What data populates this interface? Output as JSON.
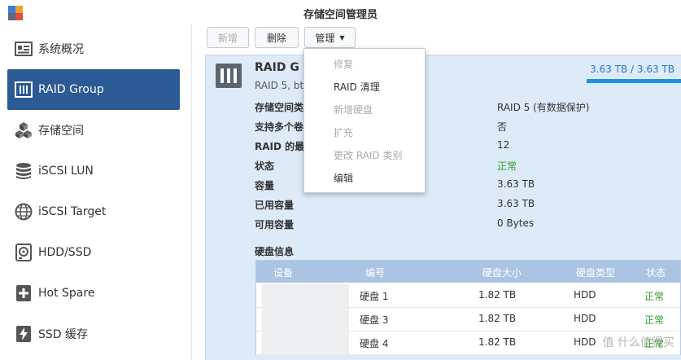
{
  "window": {
    "title": "存储空间管理员"
  },
  "sidebar": {
    "items": [
      {
        "label": "系统概况",
        "icon": "overview-icon"
      },
      {
        "label": "RAID Group",
        "icon": "raid-icon",
        "active": true
      },
      {
        "label": "存储空间",
        "icon": "cubes-icon"
      },
      {
        "label": "iSCSI LUN",
        "icon": "database-icon"
      },
      {
        "label": "iSCSI Target",
        "icon": "globe-icon"
      },
      {
        "label": "HDD/SSD",
        "icon": "disk-icon"
      },
      {
        "label": "Hot Spare",
        "icon": "hot-spare-icon"
      },
      {
        "label": "SSD 缓存",
        "icon": "lightning-icon"
      }
    ]
  },
  "toolbar": {
    "new_label": "新增",
    "delete_label": "删除",
    "manage_label": "管理"
  },
  "manage_menu": {
    "items": [
      {
        "label": "修复",
        "enabled": false
      },
      {
        "label": "RAID 清理",
        "enabled": true
      },
      {
        "label": "新增硬盘",
        "enabled": false
      },
      {
        "label": "扩充",
        "enabled": false
      },
      {
        "label": "更改 RAID 类别",
        "enabled": false
      },
      {
        "label": "编辑",
        "enabled": true
      }
    ]
  },
  "raid": {
    "title": "RAID G",
    "subtitle": "RAID 5, bt",
    "capacity_text": "3.63 TB / 3.63 TB",
    "capacity_used_fraction": 1.0,
    "info": [
      {
        "label": "存储空间类",
        "value": "RAID 5 (有数据保护)"
      },
      {
        "label": "支持多个卷",
        "value": "否"
      },
      {
        "label": "RAID 的最",
        "value": "12"
      },
      {
        "label": "状态",
        "value": "正常"
      },
      {
        "label": "容量",
        "value": "3.63 TB"
      },
      {
        "label": "已用容量",
        "value": "3.63 TB"
      },
      {
        "label": "可用容量",
        "value": "0 Bytes"
      }
    ],
    "disk_section_title": "硬盘信息",
    "disk_columns": [
      "设备",
      "编号",
      "硬盘大小",
      "硬盘类型",
      "状态"
    ],
    "disks": [
      {
        "name": "硬盘 1",
        "size": "1.82 TB",
        "type": "HDD",
        "status": "正常"
      },
      {
        "name": "硬盘 3",
        "size": "1.82 TB",
        "type": "HDD",
        "status": "正常"
      },
      {
        "name": "硬盘 4",
        "size": "1.82 TB",
        "type": "HDD",
        "status": "正常"
      }
    ]
  },
  "colors": {
    "accent": "#2b5a94",
    "ok": "#2e9e2e",
    "capacity_bar": "#1e90e0"
  },
  "watermark": "值 什么值得买"
}
